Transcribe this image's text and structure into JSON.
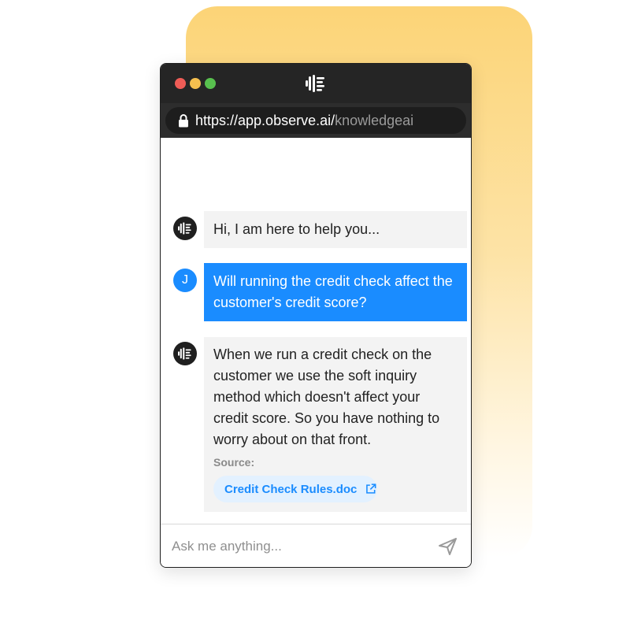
{
  "browser": {
    "url_host": "https://app.observe.ai/",
    "url_path": "knowledgeai"
  },
  "messages": [
    {
      "sender": "bot",
      "text": "Hi, I am here to help you..."
    },
    {
      "sender": "user",
      "avatar_initial": "J",
      "text": "Will running the credit check affect the customer's credit score?"
    },
    {
      "sender": "bot",
      "text": "When we run a credit check on the customer we use the soft inquiry method which doesn't affect your credit score. So you have nothing to worry about on that front."
    }
  ],
  "source": {
    "label": "Source:",
    "document": "Credit Check Rules.doc"
  },
  "composer": {
    "placeholder": "Ask me anything..."
  },
  "colors": {
    "accent": "#1a8cff",
    "titlebar": "#252525",
    "bot_bubble": "#f3f3f3",
    "background_card": "#fcd477"
  },
  "icons": {
    "brand": "observe-logo-icon",
    "lock": "lock-icon",
    "external_link": "external-link-icon",
    "send": "send-icon"
  }
}
